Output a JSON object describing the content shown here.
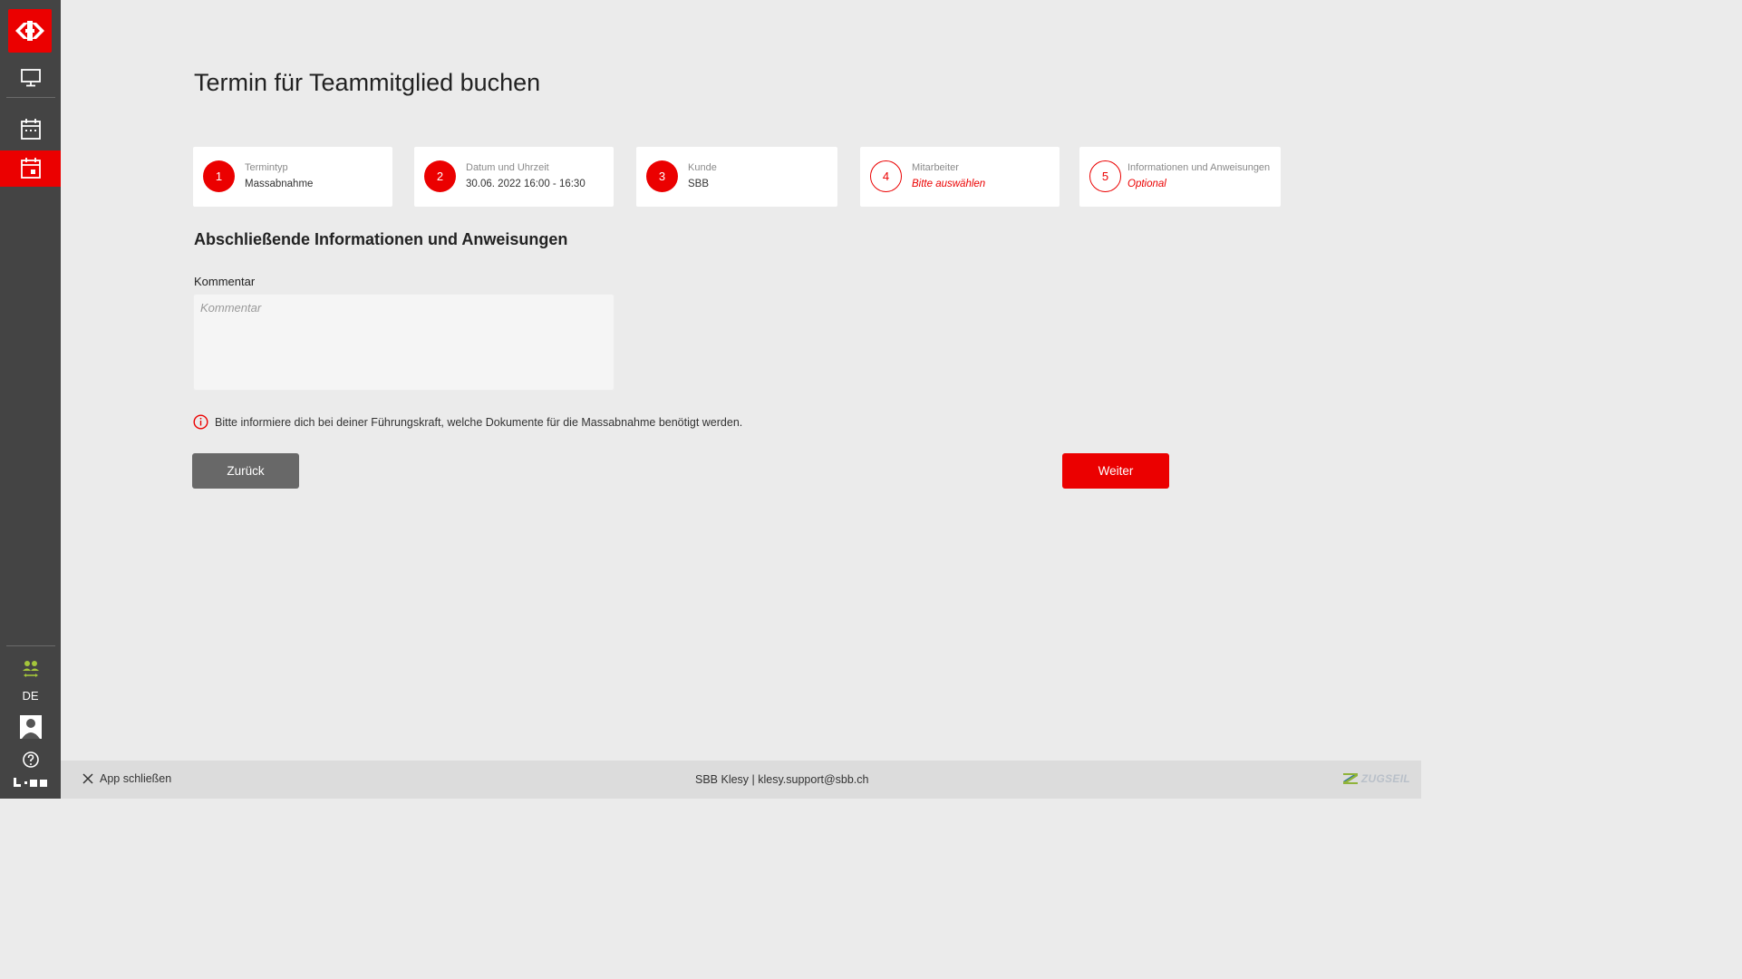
{
  "page": {
    "title": "Termin für Teammitglied buchen",
    "section_title": "Abschließende Informationen und Anweisungen"
  },
  "sidebar": {
    "items": [
      {
        "name": "sbb-logo",
        "icon": "sbb-arrows-logo"
      },
      {
        "name": "monitor",
        "icon": "monitor-icon"
      },
      {
        "name": "calendar",
        "icon": "calendar-icon"
      },
      {
        "name": "calendar-event",
        "icon": "calendar-event-icon",
        "active": true
      }
    ],
    "team_icon": "team-swap-icon",
    "language": "DE",
    "avatar_icon": "user-avatar-icon",
    "help_icon": "help-icon"
  },
  "steps": [
    {
      "number": "1",
      "label": "Termintyp",
      "value": "Massabnahme",
      "state": "done"
    },
    {
      "number": "2",
      "label": "Datum und Uhrzeit",
      "value": "30.06. 2022 16:00 - 16:30",
      "state": "done"
    },
    {
      "number": "3",
      "label": "Kunde",
      "value": "SBB",
      "state": "done"
    },
    {
      "number": "4",
      "label": "Mitarbeiter",
      "value": "Bitte auswählen",
      "state": "open"
    },
    {
      "number": "5",
      "label": "Informationen und Anweisungen",
      "value": "Optional",
      "state": "open"
    }
  ],
  "comment": {
    "label": "Kommentar",
    "placeholder": "Kommentar",
    "value": ""
  },
  "info_text": "Bitte informiere dich bei deiner Führungskraft, welche Dokumente für die Massabnahme benötigt werden.",
  "buttons": {
    "back": "Zurück",
    "next": "Weiter"
  },
  "footer": {
    "close_label": "App schließen",
    "support": "SBB Klesy | klesy.support@sbb.ch",
    "brand": "ZUGSEIL"
  },
  "colors": {
    "accent": "#eb0000",
    "sidebar": "#444444",
    "background": "#ebebeb"
  }
}
